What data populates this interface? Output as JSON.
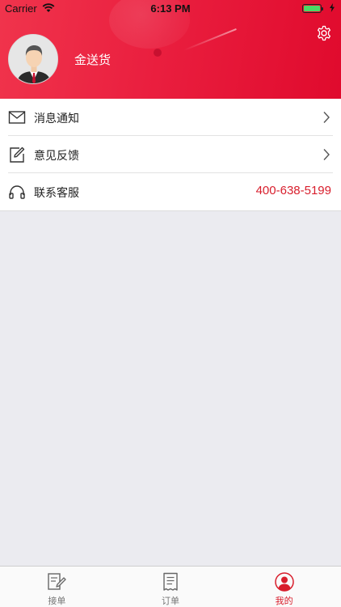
{
  "status_bar": {
    "carrier": "Carrier",
    "time": "6:13 PM",
    "battery_level": 1.0
  },
  "profile": {
    "username": "金送货",
    "avatar_icon": "businessman-avatar-icon",
    "settings_icon": "gear-icon"
  },
  "menu": {
    "items": [
      {
        "label": "消息通知",
        "icon": "envelope-icon",
        "trailing": "chevron-right-icon"
      },
      {
        "label": "意见反馈",
        "icon": "edit-icon",
        "trailing": "chevron-right-icon"
      },
      {
        "label": "联系客服",
        "icon": "headphones-icon",
        "value": "400-638-5199"
      }
    ]
  },
  "tabbar": {
    "tabs": [
      {
        "label": "接单",
        "icon": "accept-order-icon",
        "active": false
      },
      {
        "label": "订单",
        "icon": "receipt-icon",
        "active": false
      },
      {
        "label": "我的",
        "icon": "user-icon",
        "active": true
      }
    ]
  },
  "colors": {
    "brand": "#e8203f",
    "accent_text": "#d81e2c",
    "background": "#ebebf0"
  }
}
